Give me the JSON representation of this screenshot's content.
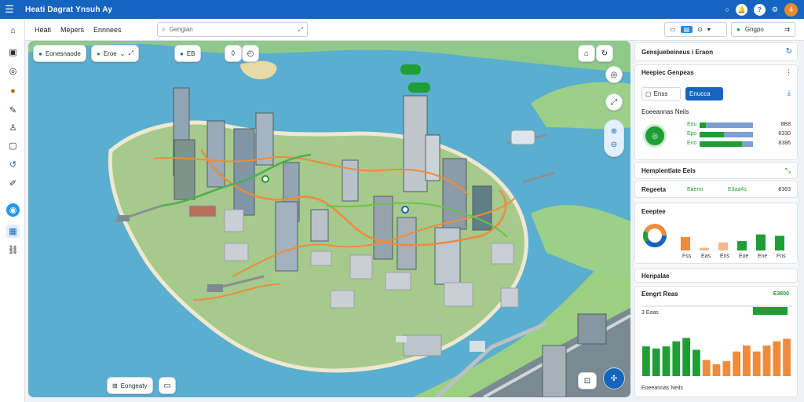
{
  "app": {
    "title": "Heati Dagrat Ynsuh Ay"
  },
  "topbar": {
    "avatar_label": "4"
  },
  "toolbar": {
    "menu": [
      "Heati",
      "Mepers",
      "Ennnees"
    ],
    "search_placeholder": "Gengian",
    "group2_label": "Gngpo"
  },
  "map": {
    "chips": [
      "Eonesnaode",
      "Eroe",
      "EB",
      "Eongeaty"
    ],
    "bottom_chip": "Eongeaty"
  },
  "panel": {
    "card1": {
      "title": "Gensjuebeineus i Eraon"
    },
    "card2": {
      "title": "Heepiec Genpeas",
      "btn1": "Enss",
      "btn2": "Enucca",
      "rows": [
        {
          "label": "Eou",
          "value": "8B8",
          "fill": 0.12
        },
        {
          "label": "Epo",
          "value": "8330",
          "fill": 0.45
        },
        {
          "label": "Eno",
          "value": "8386",
          "fill": 0.8
        }
      ]
    },
    "card3": {
      "title": "Hempientlate Eeis",
      "row_label": "Regeeta",
      "row_value1": "Eaeno",
      "row_value2": "E3aa4s",
      "row_value3": "8363"
    },
    "card4": {
      "title": "Eeeptee",
      "labels": [
        "Fss",
        "Eas",
        "Ens",
        "Eoe",
        "Ene",
        "Fns"
      ],
      "values": [
        0.5,
        0.1,
        0.3,
        0.35,
        0.6,
        0.55
      ]
    },
    "card5": {
      "title": "Henpalae",
      "subtitle": "Eengrt Reas",
      "amount": "E3800",
      "bar_label": "3 Eoas",
      "bars": [
        0.7,
        0.65,
        0.7,
        0.82,
        0.9,
        0.62,
        0.38,
        0.28,
        0.35,
        0.58,
        0.72,
        0.58,
        0.72,
        0.82,
        0.88
      ],
      "footer": "Eoeeannas Neils"
    }
  },
  "colors": {
    "accent": "#1565c0",
    "water": "#5aaed0",
    "green": "#1f9e36",
    "orange": "#ee8b3c"
  }
}
